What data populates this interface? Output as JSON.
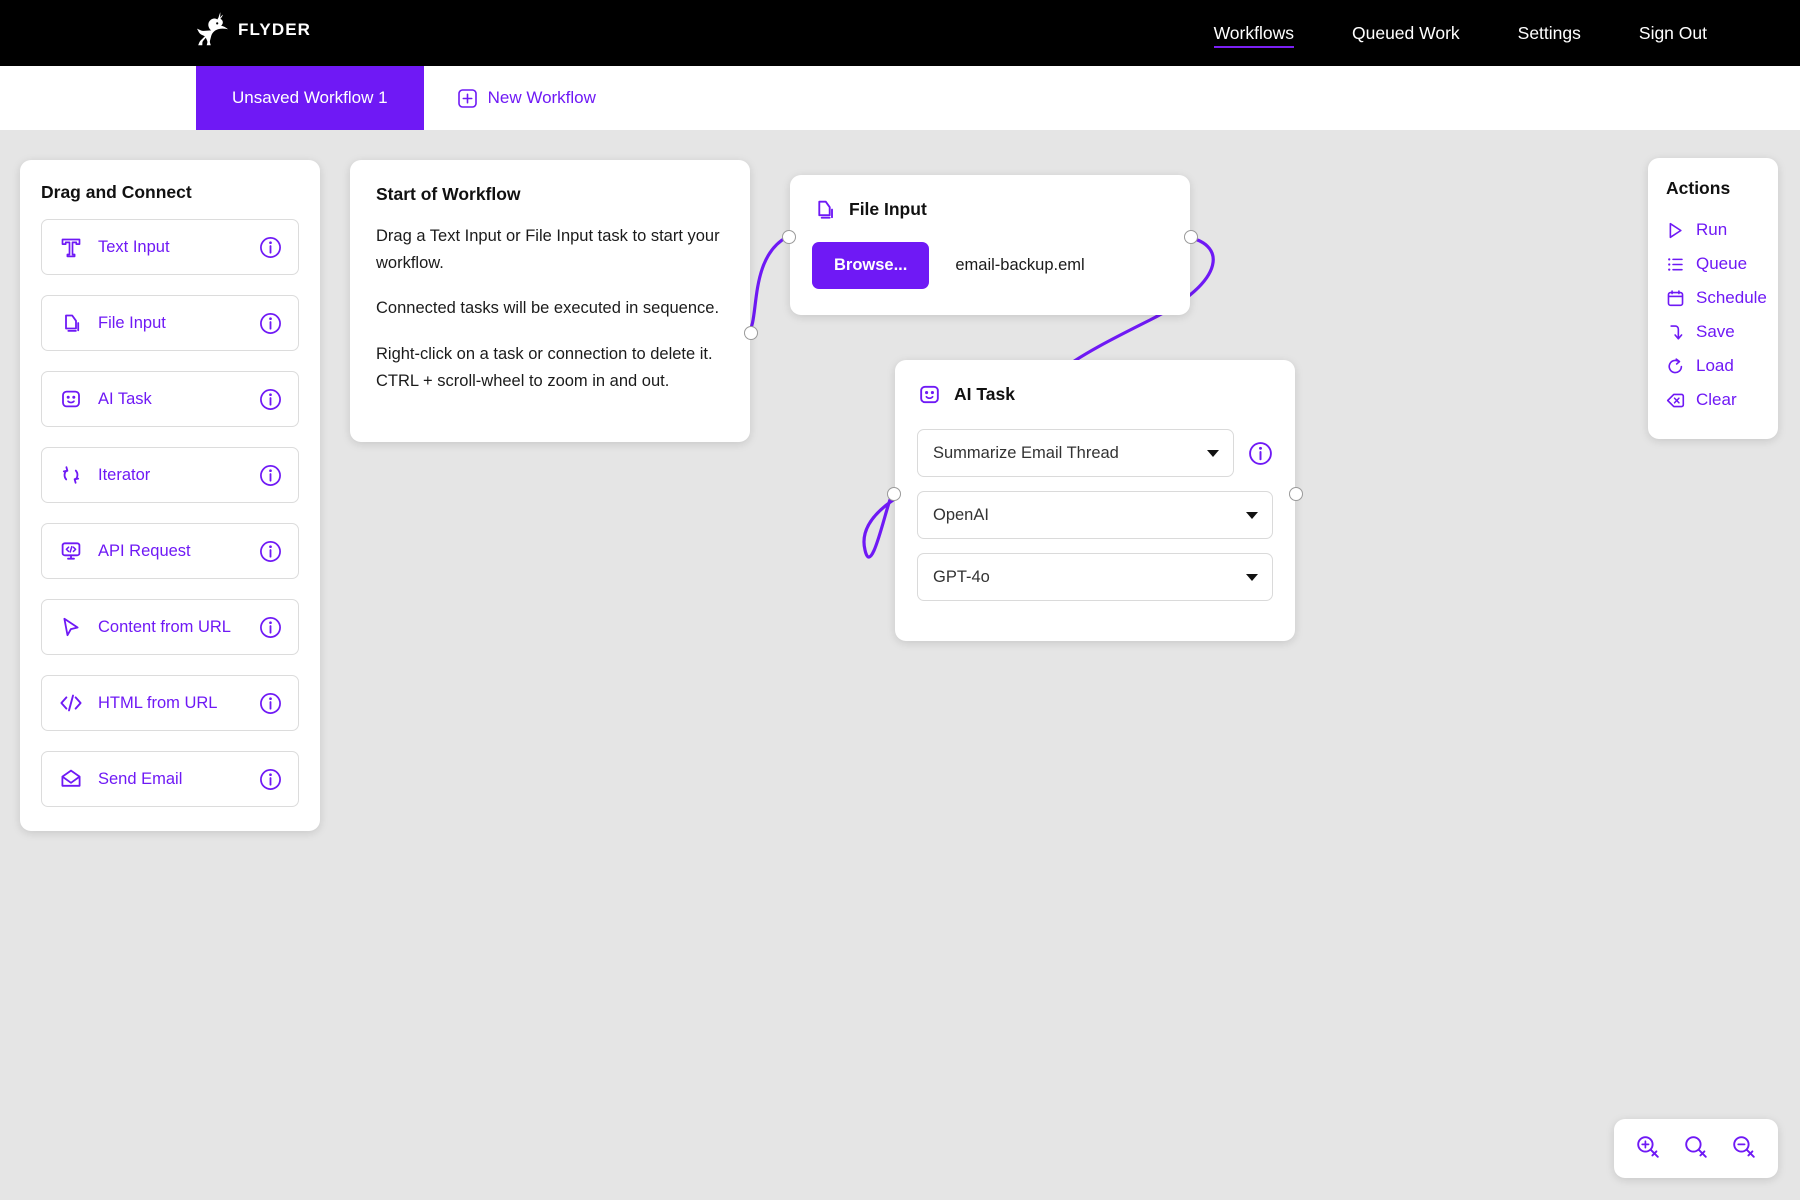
{
  "brand": {
    "name": "FLYDER",
    "logo_icon": "winged-rabbit-logo"
  },
  "topnav": {
    "items": [
      {
        "label": "Workflows",
        "active": true
      },
      {
        "label": "Queued Work",
        "active": false
      },
      {
        "label": "Settings",
        "active": false
      },
      {
        "label": "Sign Out",
        "active": false
      }
    ]
  },
  "tabs": {
    "active_tab": "Unsaved Workflow 1",
    "new_tab_label": "New Workflow",
    "new_tab_icon": "plus-square-icon"
  },
  "palette": {
    "title": "Drag and Connect",
    "info_icon": "info-circle-icon",
    "items": [
      {
        "label": "Text Input",
        "icon": "text-input-icon"
      },
      {
        "label": "File Input",
        "icon": "file-input-icon"
      },
      {
        "label": "AI Task",
        "icon": "robot-face-icon"
      },
      {
        "label": "Iterator",
        "icon": "loop-arrows-icon"
      },
      {
        "label": "API Request",
        "icon": "code-monitor-icon"
      },
      {
        "label": "Content from URL",
        "icon": "cursor-arrow-icon"
      },
      {
        "label": "HTML from URL",
        "icon": "code-brackets-icon"
      },
      {
        "label": "Send Email",
        "icon": "envelope-icon"
      }
    ]
  },
  "start_card": {
    "title": "Start of Workflow",
    "paragraphs": [
      "Drag a Text Input or File Input task to start your workflow.",
      "Connected tasks will be executed in sequence.",
      "Right-click on a task or connection to delete it. CTRL + scroll-wheel to zoom in and out."
    ]
  },
  "file_node": {
    "title": "File Input",
    "icon": "file-input-icon",
    "browse_label": "Browse...",
    "file_name": "email-backup.eml"
  },
  "ai_node": {
    "title": "AI Task",
    "icon": "robot-face-icon",
    "info_icon": "info-circle-icon",
    "selects": [
      {
        "name": "task",
        "value": "Summarize Email Thread"
      },
      {
        "name": "provider",
        "value": "OpenAI"
      },
      {
        "name": "model",
        "value": "GPT-4o"
      }
    ]
  },
  "actions": {
    "title": "Actions",
    "items": [
      {
        "label": "Run",
        "icon": "play-triangle-icon"
      },
      {
        "label": "Queue",
        "icon": "list-icon"
      },
      {
        "label": "Schedule",
        "icon": "calendar-icon"
      },
      {
        "label": "Save",
        "icon": "arrow-down-save-icon"
      },
      {
        "label": "Load",
        "icon": "refresh-load-icon"
      },
      {
        "label": "Clear",
        "icon": "clear-x-icon"
      }
    ]
  },
  "zoom_controls": [
    {
      "name": "zoom-in",
      "icon": "magnifier-plus-icon"
    },
    {
      "name": "zoom-reset",
      "icon": "magnifier-icon"
    },
    {
      "name": "zoom-out",
      "icon": "magnifier-minus-icon"
    }
  ],
  "colors": {
    "accent": "#6f19f5",
    "topbar_bg": "#000000",
    "canvas_bg": "#e5e5e5",
    "card_bg": "#ffffff"
  }
}
